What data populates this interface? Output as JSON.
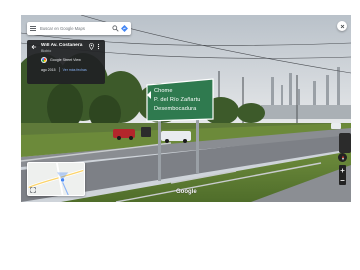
{
  "search": {
    "placeholder": "Buscar en Google Maps"
  },
  "info_card": {
    "title": "Will Av. Costanera",
    "subtitle": "Biobío",
    "author": "Google Street View",
    "date": "ago 2015",
    "see_more": "Ver más fechas"
  },
  "road_sign": {
    "lines": [
      "Chome",
      "P. del Río Zañartu",
      "Desembocadura"
    ],
    "colors": {
      "panel": "#2f7a4f",
      "text": "#ffffff"
    }
  },
  "branding": {
    "logo_text": "Google"
  },
  "icons": {
    "menu": "menu-icon",
    "search": "search-icon",
    "directions": "directions-icon",
    "back": "arrow-left-icon",
    "pin": "map-pin-icon",
    "more": "more-vert-icon",
    "close": "close-icon",
    "compass": "compass-icon",
    "zoom_in": "plus-icon",
    "zoom_out": "minus-icon",
    "expand": "expand-icon"
  },
  "colors": {
    "accent_link": "#8ab4f8",
    "card_bg": "#202124",
    "google_blue": "#4285f4"
  }
}
